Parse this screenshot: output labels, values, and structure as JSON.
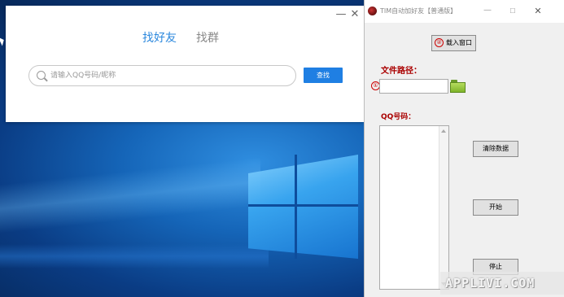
{
  "find_dialog": {
    "min_glyph": "—",
    "close_glyph": "✕",
    "tabs": [
      {
        "label": "找好友",
        "active": true
      },
      {
        "label": "找群",
        "active": false
      }
    ],
    "search": {
      "placeholder": "请输入QQ号码/昵称",
      "value": ""
    },
    "find_button_label": "查找"
  },
  "tool_window": {
    "title": "TIM自动加好友【普通版】",
    "min_glyph": "—",
    "max_glyph": "☐",
    "close_glyph": "✕",
    "load_window": {
      "badge": "②",
      "label": "载入窗口"
    },
    "file_path": {
      "badge": "①",
      "label": "文件路径：",
      "value": ""
    },
    "qq_label": "QQ号码：",
    "buttons": {
      "clear": "清除数据",
      "start": "开始",
      "stop": "停止"
    }
  },
  "watermark": "APPLIVI.COM",
  "colors": {
    "accent_blue": "#1f7fe3",
    "tab_active": "#2c88dd",
    "label_red": "#aa0000"
  }
}
